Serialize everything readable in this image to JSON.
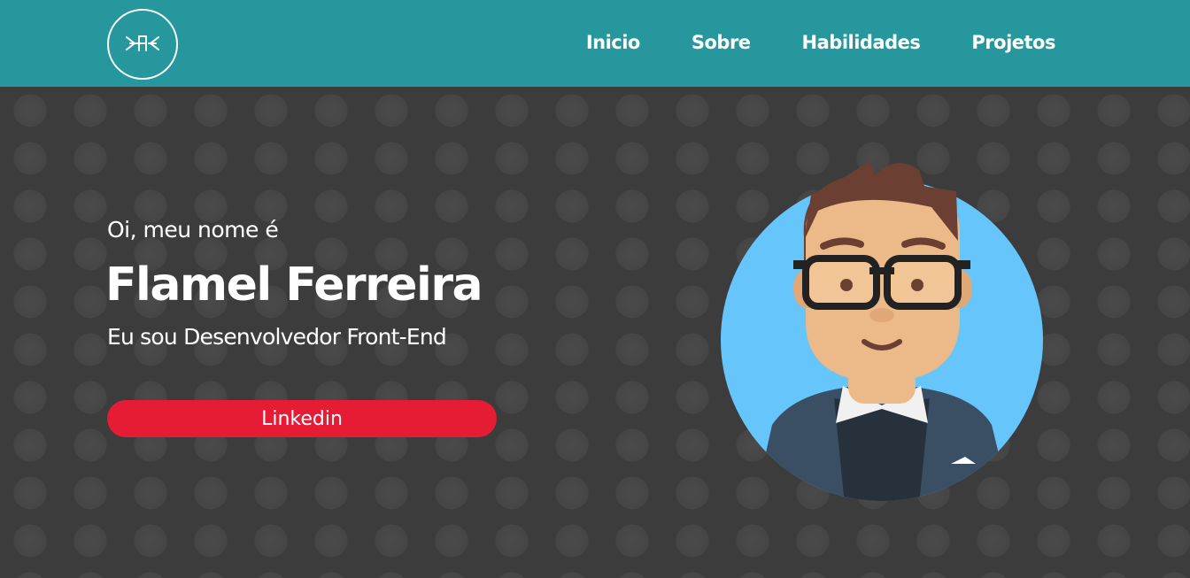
{
  "header": {
    "logo_alt": "logo",
    "nav": [
      {
        "label": "Inicio"
      },
      {
        "label": "Sobre"
      },
      {
        "label": "Habilidades"
      },
      {
        "label": "Projetos"
      }
    ]
  },
  "hero": {
    "greeting": "Oi, meu nome é",
    "name": "Flamel Ferreira",
    "role": "Eu sou Desenvolvedor Front-End",
    "cta_label": "Linkedin"
  },
  "colors": {
    "header_bg": "#26979d",
    "hero_bg": "#3c3c3c",
    "cta_bg": "#e61c35",
    "avatar_bg": "#66c5fb"
  }
}
